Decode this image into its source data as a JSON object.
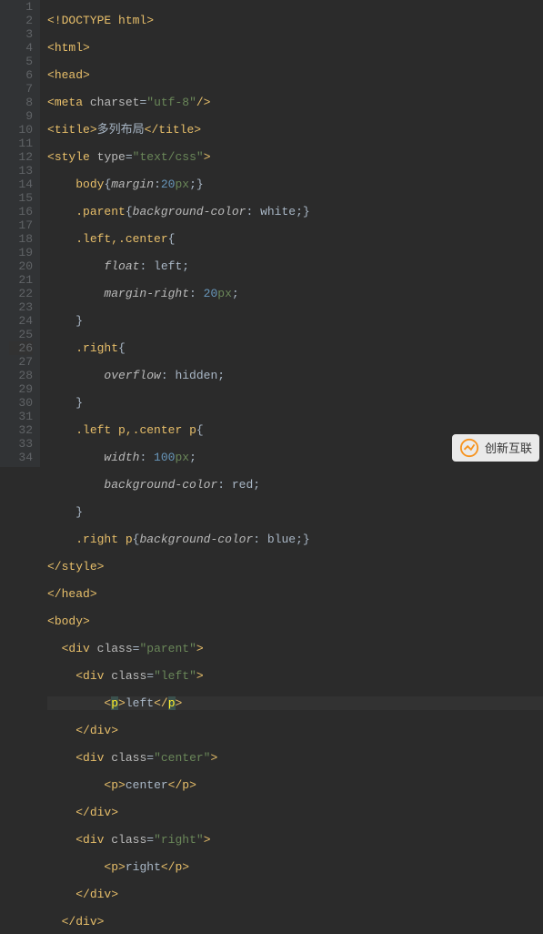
{
  "lineNumbers": [
    "1",
    "2",
    "3",
    "4",
    "5",
    "6",
    "7",
    "8",
    "9",
    "10",
    "11",
    "12",
    "13",
    "14",
    "15",
    "16",
    "17",
    "18",
    "19",
    "20",
    "21",
    "22",
    "23",
    "24",
    "25",
    "26",
    "27",
    "28",
    "29",
    "30",
    "31",
    "32",
    "33",
    "34"
  ],
  "activeLine": 26,
  "watermark": {
    "text": "创新互联"
  },
  "code": {
    "l1": "<!DOCTYPE html>",
    "l4_attr": "charset",
    "l4_val": "\"utf-8\"",
    "l5_title": "多列布局",
    "l6_attr": "type",
    "l6_val": "\"text/css\"",
    "l7_sel": "body",
    "l7_prop": "margin",
    "l7_num": "20",
    "l7_unit": "px",
    "l8_sel": ".parent",
    "l8_prop": "background-color",
    "l8_val": "white",
    "l9_sel": ".left,.center",
    "l10_prop": "float",
    "l10_val": "left",
    "l11_prop": "margin-right",
    "l11_num": "20",
    "l11_unit": "px",
    "l13_sel": ".right",
    "l14_prop": "overflow",
    "l14_val": "hidden",
    "l16_sel1": ".left ",
    "l16_tag1": "p",
    "l16_sel2": ",.center ",
    "l16_tag2": "p",
    "l17_prop": "width",
    "l17_num": "100",
    "l17_unit": "px",
    "l18_prop": "background-color",
    "l18_val": "red",
    "l20_sel": ".right ",
    "l20_tag": "p",
    "l20_prop": "background-color",
    "l20_val": "blue",
    "l24_attr": "class",
    "l24_val": "\"parent\"",
    "l25_attr": "class",
    "l25_val": "\"left\"",
    "l26_text": "left",
    "l28_attr": "class",
    "l28_val": "\"center\"",
    "l29_text": "center",
    "l31_attr": "class",
    "l31_val": "\"right\"",
    "l32_text": "right"
  }
}
